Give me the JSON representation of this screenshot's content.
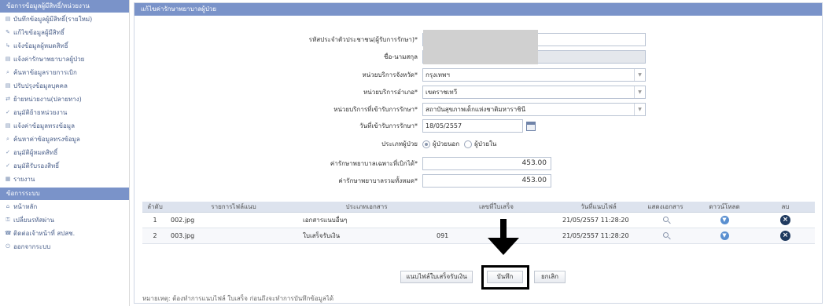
{
  "sidebar": {
    "header": "ข้อการข้อมูลผู้มีสิทธิ์/หน่วยงาน",
    "items": [
      {
        "label": "บันทึกข้อมูลผู้มีสิทธิ์(รายใหม่)",
        "icon": "page-icon"
      },
      {
        "label": "แก้ไขข้อมูลผู้มีสิทธิ์",
        "icon": "edit-icon"
      },
      {
        "label": "แจ้งข้อมูลผู้หมดสิทธิ์",
        "icon": "arrow-icon"
      },
      {
        "label": "แจ้งค่ารักษาพยาบาลผู้ป่วย",
        "icon": "page-icon"
      },
      {
        "label": "ค้นหาข้อมูลรายการเบิก",
        "icon": "search-icon"
      },
      {
        "label": "ปรับปรุงข้อมูลบุคคล",
        "icon": "page-icon"
      },
      {
        "label": "ย้ายหน่วยงาน(ปลายทาง)",
        "icon": "move-icon"
      },
      {
        "label": "อนุมัติย้ายหน่วยงาน",
        "icon": "approve-icon"
      },
      {
        "label": "แจ้งค่าข้อมูลทรงข้อมูล",
        "icon": "page-icon"
      },
      {
        "label": "ค้นหาค่าข้อมูลทรงข้อมูล",
        "icon": "search-icon"
      },
      {
        "label": "อนุมัติผู้หมดสิทธิ์",
        "icon": "approve-icon"
      },
      {
        "label": "อนุมัติรับรองสิทธิ์",
        "icon": "approve-icon"
      },
      {
        "label": "รายงาน",
        "icon": "report-icon"
      }
    ],
    "header2": "ข้อการระบบ",
    "items2": [
      {
        "label": "หน้าหลัก",
        "icon": "home-icon"
      },
      {
        "label": "เปลี่ยนรหัสผ่าน",
        "icon": "key-icon"
      },
      {
        "label": "ติดต่อเจ้าหน้าที่ สปสช.",
        "icon": "contact-icon"
      },
      {
        "label": "ออกจากระบบ",
        "icon": "logout-icon"
      }
    ]
  },
  "main": {
    "title": "แก้ไขค่ารักษาพยาบาลผู้ป่วย",
    "form": {
      "id_label": "รหัสประจำตัวประชาชน(ผู้รับการรักษา)*",
      "name_label": "ชื่อ-นามสกุล",
      "province_label": "หน่วยบริการจังหวัด*",
      "province_value": "กรุงเทพฯ",
      "district_label": "หน่วยบริการอำเภอ*",
      "district_value": "เขตราชเทวี",
      "hospital_label": "หน่วยบริการที่เข้ารับการรักษา*",
      "hospital_value": "สถาบันสุขภาพเด็กแห่งชาติมหาราชินี",
      "date_label": "วันที่เข้ารับการรักษา*",
      "date_value": "18/05/2557",
      "patient_type_label": "ประเภทผู้ป่วย",
      "patient_type_options": [
        "ผู้ป่วยนอก",
        "ผู้ป่วยใน"
      ],
      "claimable_label": "ค่ารักษาพยาบาลเฉพาะที่เบิกได้*",
      "claimable_value": "453.00",
      "total_label": "ค่ารักษาพยาบาลรวมทั้งหมด*",
      "total_value": "453.00"
    },
    "table": {
      "headers": [
        "ลำดับ",
        "รายการไฟล์แนบ",
        "ประเภทเอกสาร",
        "เลขที่ใบเสร็จ",
        "วันที่แนบไฟล์",
        "แสดงเอกสาร",
        "ดาวน์โหลด",
        "ลบ"
      ],
      "rows": [
        {
          "no": "1",
          "file": "002.jpg",
          "doctype": "เอกสารแนบอื่นๆ",
          "receipt": "",
          "date": "21/05/2557 11:28:20"
        },
        {
          "no": "2",
          "file": "003.jpg",
          "doctype": "ใบเสร็จรับเงิน",
          "receipt": "091",
          "date": "21/05/2557 11:28:20"
        }
      ]
    },
    "buttons": {
      "attach": "แนบไฟล์ใบเสร็จรับเงิน",
      "save": "บันทึก",
      "cancel": "ยกเลิก"
    },
    "note": "หมายเหตุ: ต้องทำการแนบไฟล์ ใบเสร็จ ก่อนถึงจะทำการบันทึกข้อมูลได้"
  },
  "colors": {
    "header_bg": "#7a93c9",
    "redaction": "#d0d0d0",
    "highlight": "#000000"
  }
}
